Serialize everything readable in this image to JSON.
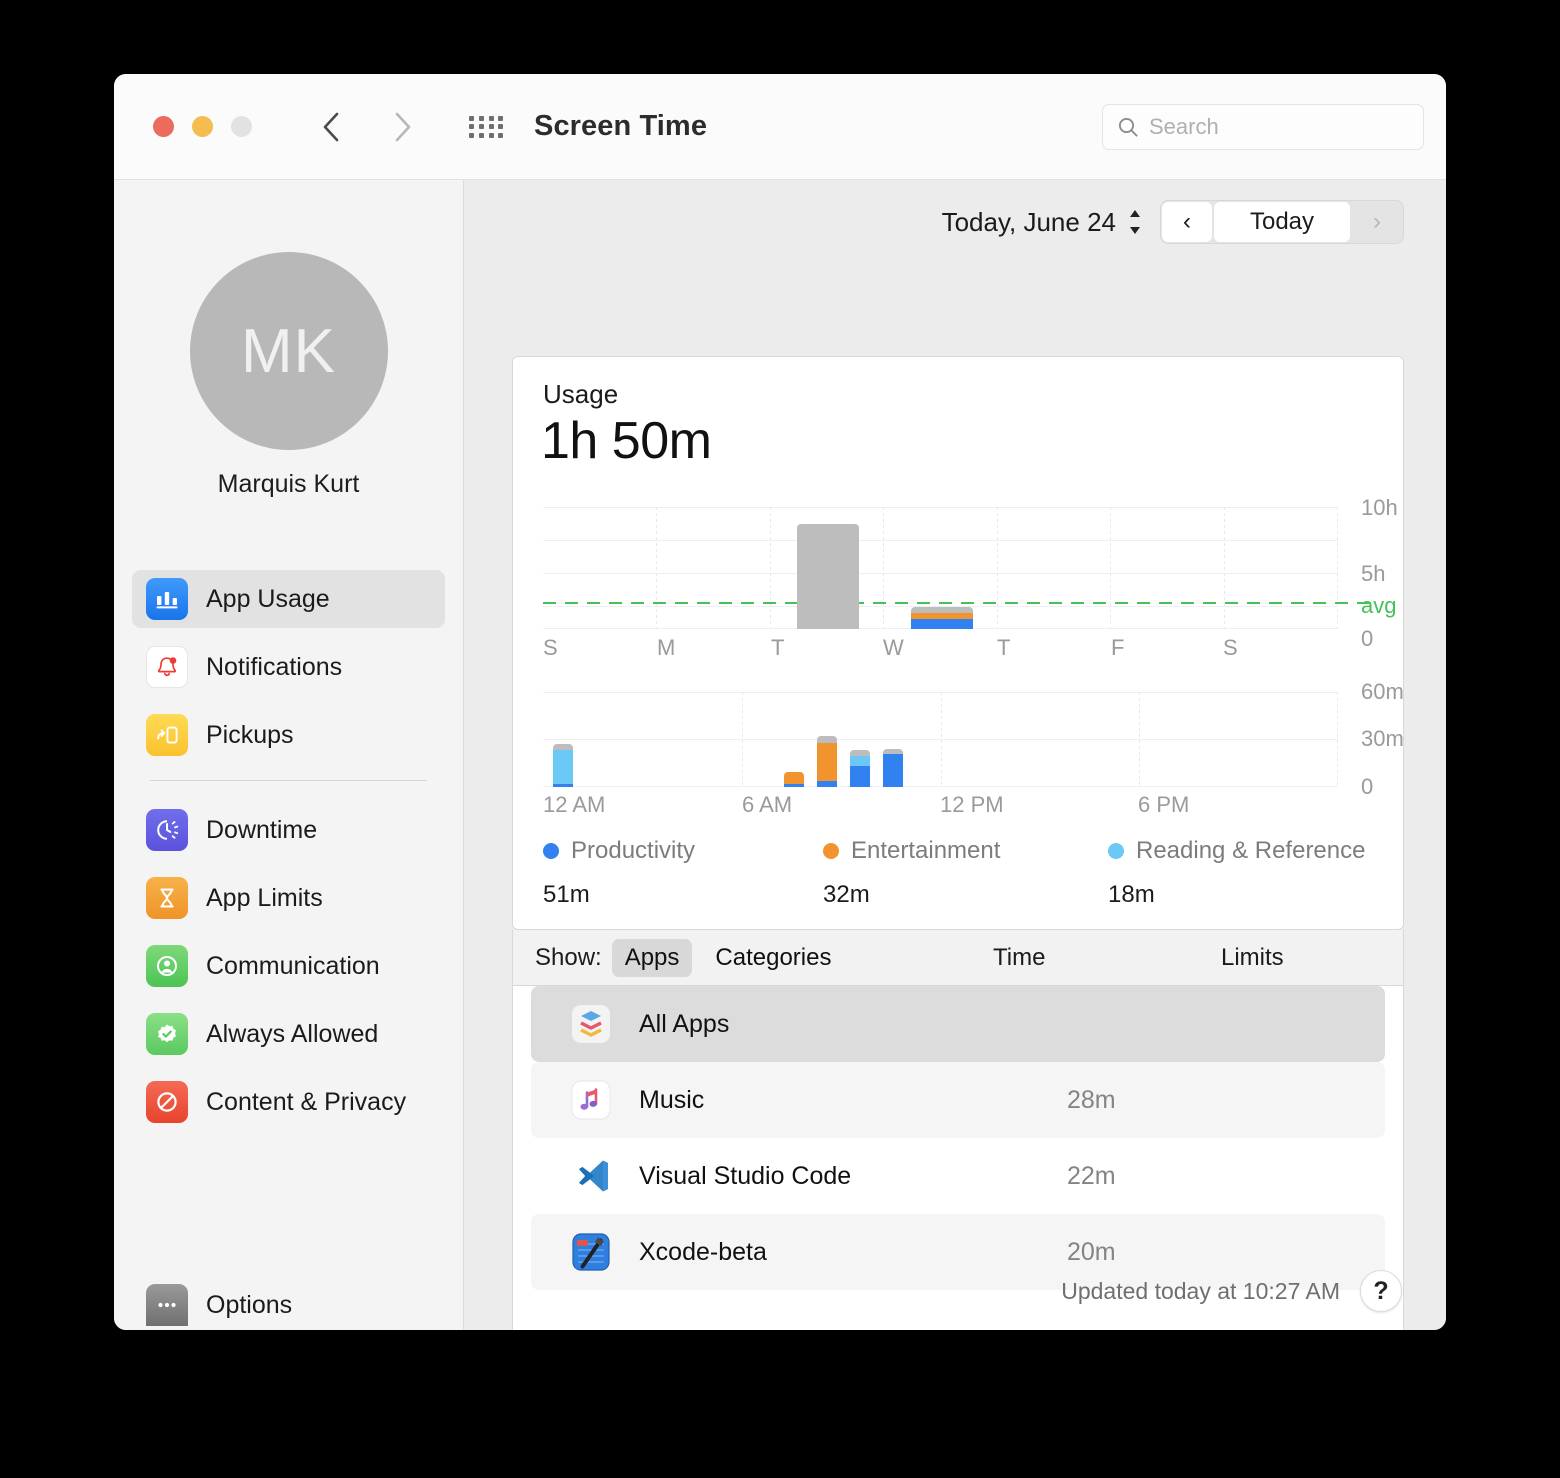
{
  "window": {
    "title": "Screen Time",
    "traffic_lights": [
      "close",
      "minimize",
      "zoom"
    ],
    "back_icon": "chevron-left-icon",
    "forward_icon": "chevron-right-icon",
    "grid_icon": "grid-apps-icon"
  },
  "search": {
    "placeholder": "Search",
    "icon": "search-icon"
  },
  "profile": {
    "initials": "MK",
    "name": "Marquis Kurt"
  },
  "sidebar": {
    "items": [
      {
        "label": "App Usage",
        "icon": "bar-chart-icon",
        "selected": true
      },
      {
        "label": "Notifications",
        "icon": "bell-icon",
        "selected": false
      },
      {
        "label": "Pickups",
        "icon": "phone-pickup-icon",
        "selected": false
      }
    ],
    "items2": [
      {
        "label": "Downtime",
        "icon": "moon-clock-icon",
        "selected": false
      },
      {
        "label": "App Limits",
        "icon": "hourglass-icon",
        "selected": false
      },
      {
        "label": "Communication",
        "icon": "person-circle-icon",
        "selected": false
      },
      {
        "label": "Always Allowed",
        "icon": "check-badge-icon",
        "selected": false
      },
      {
        "label": "Content & Privacy",
        "icon": "prohibition-icon",
        "selected": false
      }
    ],
    "options": {
      "label": "Options",
      "icon": "ellipsis-icon"
    }
  },
  "datebar": {
    "date_label": "Today, June 24",
    "stepper_icon": "up-down-stepper-icon",
    "prev_label": "‹",
    "today_label": "Today",
    "next_label": "›"
  },
  "usage": {
    "heading": "Usage",
    "total": "1h 50m"
  },
  "show_row": {
    "label": "Show:",
    "apps_label": "Apps",
    "categories_label": "Categories",
    "selected": "Apps",
    "col_time": "Time",
    "col_limits": "Limits"
  },
  "apps": [
    {
      "name": "All Apps",
      "time": "",
      "icon": "layers-icon",
      "selected": true
    },
    {
      "name": "Music",
      "time": "28m",
      "icon": "music-note-icon",
      "selected": false
    },
    {
      "name": "Visual Studio Code",
      "time": "22m",
      "icon": "vscode-icon",
      "selected": false
    },
    {
      "name": "Xcode-beta",
      "time": "20m",
      "icon": "xcode-icon",
      "selected": false
    }
  ],
  "footer": {
    "updated": "Updated today at 10:27 AM",
    "help_icon": "question-mark-icon"
  },
  "colors": {
    "productivity": "#3182f0",
    "entertainment": "#f1932e",
    "reading": "#6cc8f4",
    "other": "#bdbdbd",
    "avg_line": "#46c15a",
    "accent": "#1a74ea"
  },
  "chart_data": [
    {
      "type": "bar",
      "name": "weekly-usage-chart",
      "title": "",
      "xlabel": "",
      "ylabel": "",
      "categories": [
        "S",
        "M",
        "T",
        "W",
        "T",
        "F",
        "S"
      ],
      "tick_labels_y": [
        "10h",
        "5h",
        "avg",
        "0"
      ],
      "ylim": [
        0,
        10
      ],
      "yunit": "hours",
      "grid": true,
      "legend": "none",
      "average_line": {
        "label": "avg",
        "value": 2.2,
        "color": "#46c15a",
        "style": "dashed"
      },
      "series": [
        {
          "name": "Productivity",
          "color": "#3182f0",
          "values": [
            0,
            0,
            0,
            0.85,
            0,
            0,
            0
          ]
        },
        {
          "name": "Entertainment",
          "color": "#f1932e",
          "values": [
            0,
            0,
            0,
            0.53,
            0,
            0,
            0
          ]
        },
        {
          "name": "Reading & Reference",
          "color": "#6cc8f4",
          "values": [
            0,
            0,
            0,
            0,
            0,
            0,
            0
          ]
        },
        {
          "name": "Other",
          "color": "#bdbdbd",
          "values": [
            0,
            0,
            8.65,
            0.45,
            0,
            0,
            0
          ]
        }
      ]
    },
    {
      "type": "bar",
      "name": "hourly-usage-chart",
      "title": "",
      "xlabel": "",
      "ylabel": "",
      "tick_labels_x": [
        "12 AM",
        "6 AM",
        "12 PM",
        "6 PM"
      ],
      "tick_labels_y": [
        "60m",
        "30m",
        "0"
      ],
      "ylim": [
        0,
        60
      ],
      "yunit": "minutes",
      "grid": true,
      "hours": [
        0,
        5,
        7,
        8,
        9
      ],
      "series": [
        {
          "name": "Productivity",
          "color": "#3182f0",
          "values": [
            2,
            1,
            4,
            13,
            21
          ]
        },
        {
          "name": "Entertainment",
          "color": "#f1932e",
          "values": [
            0,
            8,
            24,
            0,
            0
          ]
        },
        {
          "name": "Reading & Reference",
          "color": "#6cc8f4",
          "values": [
            21,
            0,
            0,
            6,
            0
          ]
        },
        {
          "name": "Other",
          "color": "#bdbdbd",
          "values": [
            4,
            0,
            4,
            4,
            3
          ]
        }
      ]
    }
  ],
  "legend": {
    "items": [
      {
        "name": "Productivity",
        "value": "51m",
        "color": "#3182f0"
      },
      {
        "name": "Entertainment",
        "value": "32m",
        "color": "#f1932e"
      },
      {
        "name": "Reading & Reference",
        "value": "18m",
        "color": "#6cc8f4"
      }
    ]
  }
}
